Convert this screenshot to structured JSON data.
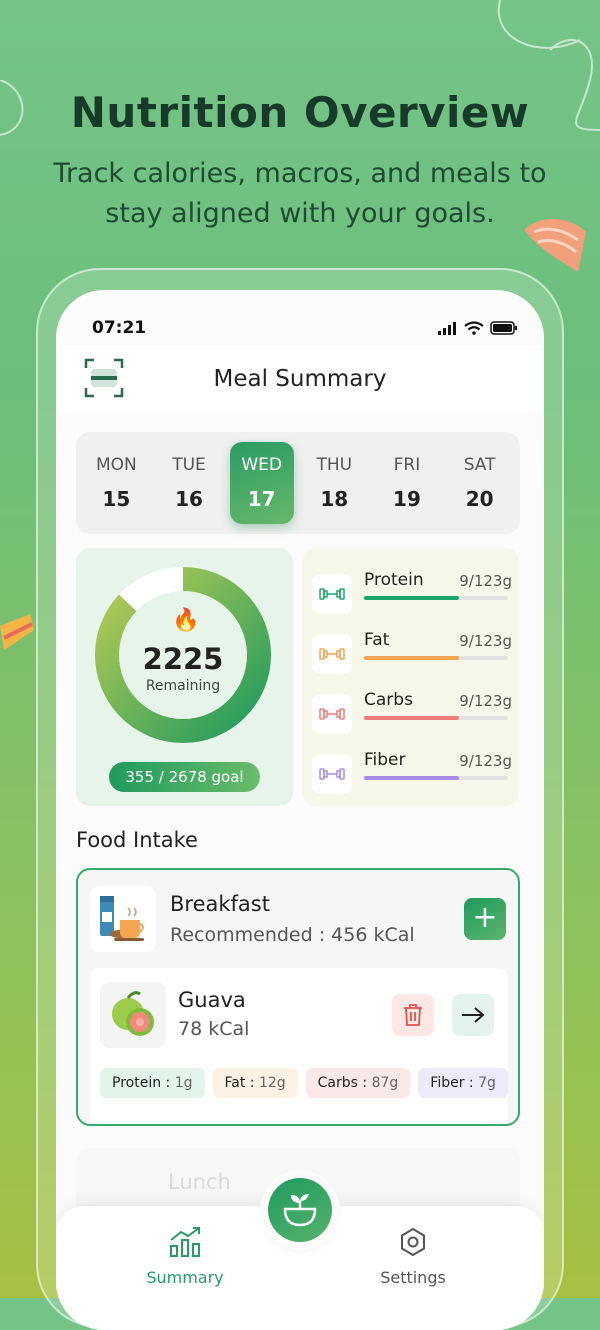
{
  "hero": {
    "title": "Nutrition Overview",
    "subtitle": "Track calories, macros, and meals to stay aligned with your goals."
  },
  "status_bar": {
    "time": "07:21"
  },
  "header": {
    "title": "Meal Summary"
  },
  "days": [
    {
      "name": "MON",
      "date": "15"
    },
    {
      "name": "TUE",
      "date": "16"
    },
    {
      "name": "WED",
      "date": "17",
      "selected": true
    },
    {
      "name": "THU",
      "date": "18"
    },
    {
      "name": "FRI",
      "date": "19"
    },
    {
      "name": "SAT",
      "date": "20"
    }
  ],
  "calories": {
    "remaining": "2225",
    "remaining_label": "Remaining",
    "goal_text": "355 / 2678 goal",
    "progress": 0.87
  },
  "macros": [
    {
      "name": "Protein",
      "value": "9/123g",
      "color": "#1aa56d",
      "fill": 0.66
    },
    {
      "name": "Fat",
      "value": "9/123g",
      "color": "#f3a552",
      "fill": 0.66
    },
    {
      "name": "Carbs",
      "value": "9/123g",
      "color": "#f07b7b",
      "fill": 0.66
    },
    {
      "name": "Fiber",
      "value": "9/123g",
      "color": "#a98ae6",
      "fill": 0.66
    }
  ],
  "food_intake": {
    "title": "Food Intake",
    "meal": {
      "name": "Breakfast",
      "recommended": "Recommended : 456 kCal"
    },
    "item": {
      "name": "Guava",
      "kcal": "78 kCal",
      "chips": [
        {
          "label": "Protein : ",
          "value": "1g",
          "bg": "#e3f4ea"
        },
        {
          "label": "Fat : ",
          "value": "12g",
          "bg": "#fdf1e4"
        },
        {
          "label": "Carbs : ",
          "value": "87g",
          "bg": "#fbe9e9"
        },
        {
          "label": "Fiber : ",
          "value": "7g",
          "bg": "#efeafa"
        }
      ]
    },
    "next_meal": "Lunch"
  },
  "nav": {
    "summary": "Summary",
    "settings": "Settings"
  },
  "colors": {
    "accent": "#1f9a5e",
    "background_top": "#74c488",
    "background_bottom": "#a7c142"
  }
}
